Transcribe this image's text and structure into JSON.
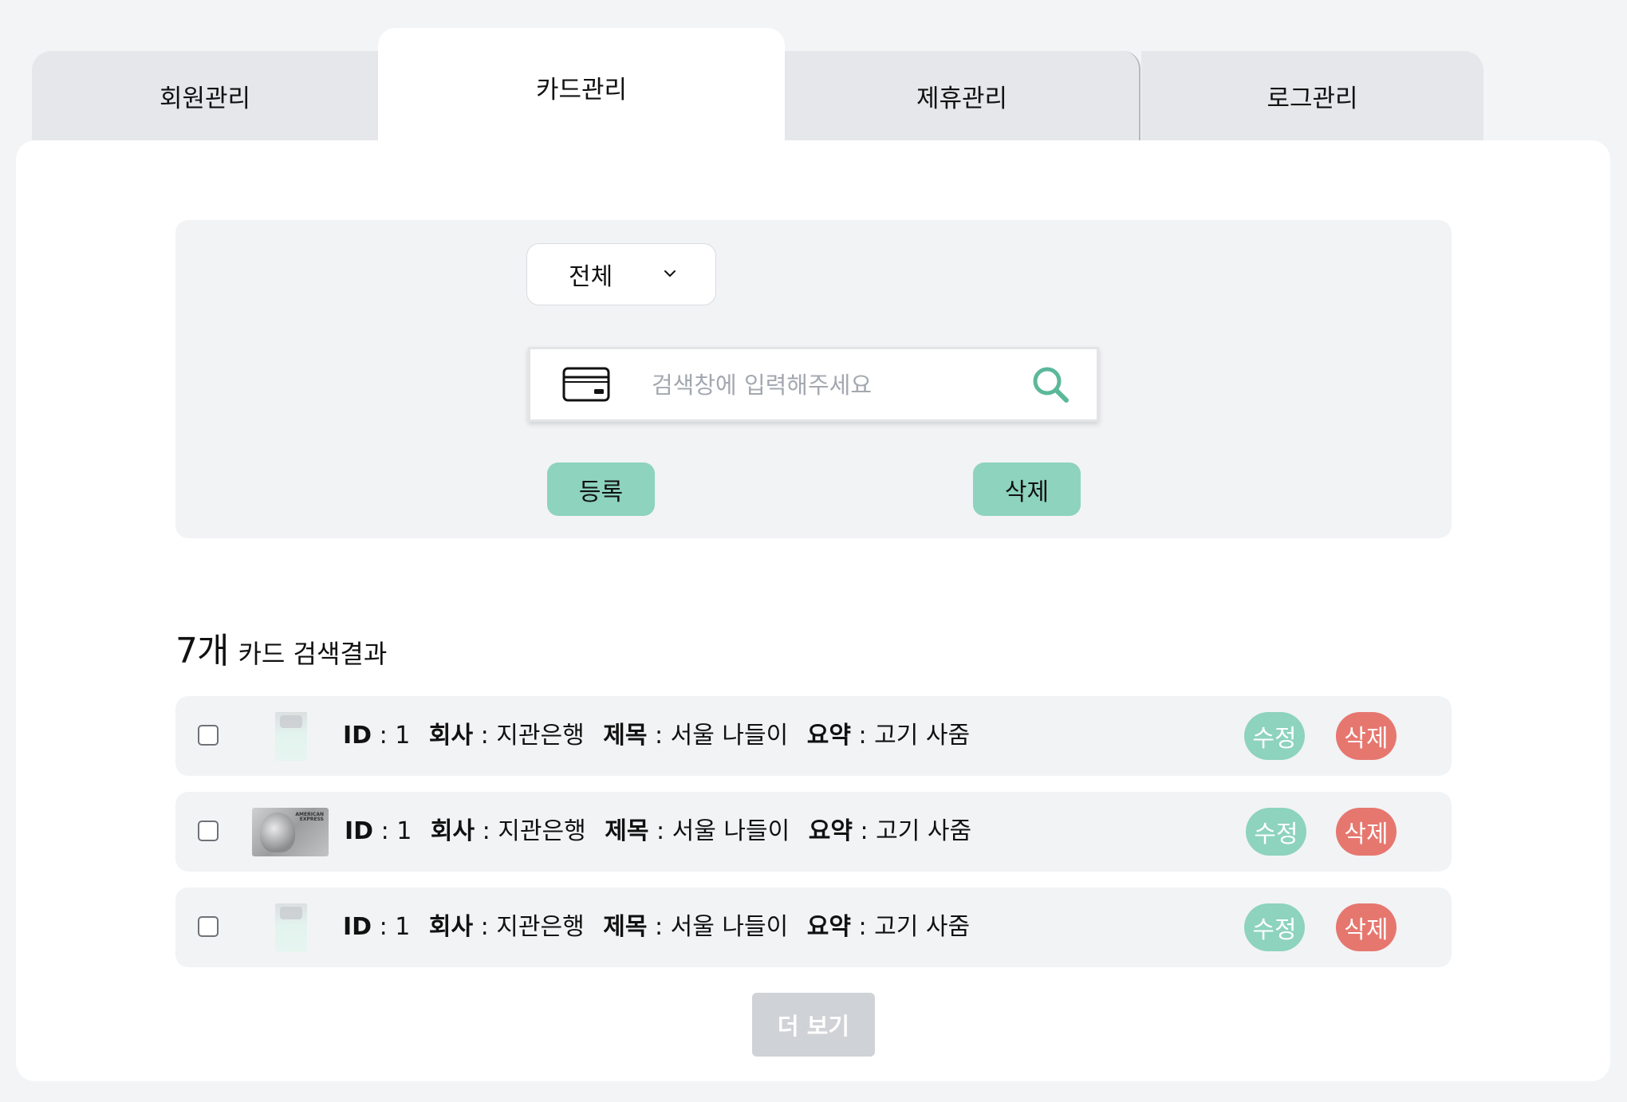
{
  "tabs": [
    {
      "label": "회원관리"
    },
    {
      "label": "카드관리"
    },
    {
      "label": "제휴관리"
    },
    {
      "label": "로그관리"
    }
  ],
  "search": {
    "select_value": "전체",
    "placeholder": "검색창에 입력해주세요",
    "register_label": "등록",
    "delete_label": "삭제"
  },
  "results": {
    "count": "7개",
    "label": "카드 검색결과"
  },
  "labels": {
    "id": "ID",
    "company": "회사",
    "title": "제목",
    "summary": "요약",
    "edit": "수정",
    "delete": "삭제"
  },
  "rows": [
    {
      "id": "1",
      "company": "지관은행",
      "title": "서울 나들이",
      "summary": "고기 사줌",
      "thumb": "light-card"
    },
    {
      "id": "1",
      "company": "지관은행",
      "title": "서울 나들이",
      "summary": "고기 사줌",
      "thumb": "amex-card"
    },
    {
      "id": "1",
      "company": "지관은행",
      "title": "서울 나들이",
      "summary": "고기 사줌",
      "thumb": "light-card"
    }
  ],
  "amex_brand": "AMERICAN\nEXPRESS",
  "more_label": "더 보기",
  "colors": {
    "accent": "#8dd3be",
    "danger": "#e6776f",
    "search_icon": "#5bb89a",
    "disabled": "#cfd2d6"
  }
}
